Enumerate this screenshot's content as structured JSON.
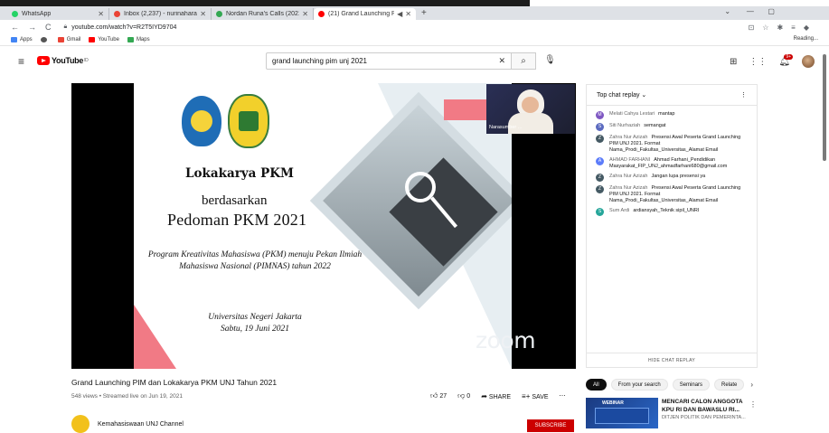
{
  "browser": {
    "tabs": [
      {
        "label": "WhatsApp",
        "color": "#25d366"
      },
      {
        "label": "Inbox (2,237) - nurinaharai@gm...",
        "color": "#ea4335"
      },
      {
        "label": "Nordan Runa's Calls (2021) Epis...",
        "color": "#34a853"
      },
      {
        "label": "(21) Grand Launching PIM d...",
        "color": "#ff0000"
      }
    ],
    "url": "youtube.com/watch?v=R2T5IYD9704",
    "bookmarks": [
      {
        "label": "Apps",
        "color": "#4285f4"
      },
      {
        "label": "",
        "color": "#555555"
      },
      {
        "label": "Gmail",
        "color": "#ea4335"
      },
      {
        "label": "YouTube",
        "color": "#ff0000"
      },
      {
        "label": "Maps",
        "color": "#34a853"
      }
    ],
    "reading_list": "Reading..."
  },
  "youtube": {
    "logo_text": "YouTube",
    "logo_sup": "ID",
    "search_value": "grand launching pim unj 2021",
    "notification_count": "9+"
  },
  "slide": {
    "title": "Lokakarya PKM",
    "subtitle1": "berdasarkan",
    "subtitle2": "Pedoman PKM 2021",
    "desc": "Program Kreativitas Mahasiswa (PKM) menuju Pekan Ilmiah Mahasiswa Nasional (PIMNAS) tahun 2022",
    "place": "Universitas Negeri Jakarta",
    "date": "Sabtu, 19 Juni 2021",
    "watermark": "zoom",
    "speaker": "Narasumber ..."
  },
  "chat": {
    "header": "Top chat replay",
    "hide": "HIDE CHAT REPLAY",
    "messages": [
      {
        "initial": "M",
        "color": "#7e57c2",
        "author": "Melati Cahya Lestari",
        "text": "mantap"
      },
      {
        "initial": "S",
        "color": "#5c6bc0",
        "author": "Siti Nurhaziah",
        "text": "semangat"
      },
      {
        "initial": "Z",
        "color": "#455a64",
        "author": "Zahra Nur Azizah",
        "text": "Presensi Awal Peserta Grand Launching PIM UNJ 2021. Format Nama_Prodi_Fakultas_Universitas_Alamat Email"
      },
      {
        "initial": "A",
        "color": "#5c7cfa",
        "author": "AHMAD FARHANI",
        "text": "Ahmad Farhani_Pendidikan Masyarakat_FIP_UNJ_ahmadfarhani680@gmail.com"
      },
      {
        "initial": "Z",
        "color": "#455a64",
        "author": "Zahra Nur Azizah",
        "text": "Jangan lupa presensi ya"
      },
      {
        "initial": "Z",
        "color": "#455a64",
        "author": "Zahra Nur Azizah",
        "text": "Presensi Awal Peserta Grand Launching PIM UNJ 2021. Format Nama_Prodi_Fakultas_Universitas_Alamat Email"
      },
      {
        "initial": "S",
        "color": "#26a69a",
        "author": "Sum Ardi",
        "text": "ardiansyah_Teknik sipil_UNRI"
      }
    ]
  },
  "video": {
    "title": "Grand Launching PIM dan Lokakarya PKM UNJ Tahun 2021",
    "meta": "548 views • Streamed live on Jun 19, 2021",
    "likes": "27",
    "dislikes": "0",
    "share": "SHARE",
    "save": "SAVE",
    "channel": "Kemahasiswaan UNJ Channel",
    "subscribe": "SUBSCRIBE"
  },
  "chips": [
    "All",
    "From your search",
    "Seminars",
    "Relate"
  ],
  "recommendation": {
    "thumb_text": "WEBINAR",
    "title": "MENCARI CALON ANGGOTA KPU RI DAN BAWASLU RI...",
    "channel": "DITJEN POLITIK DAN PEMERINTA..."
  }
}
